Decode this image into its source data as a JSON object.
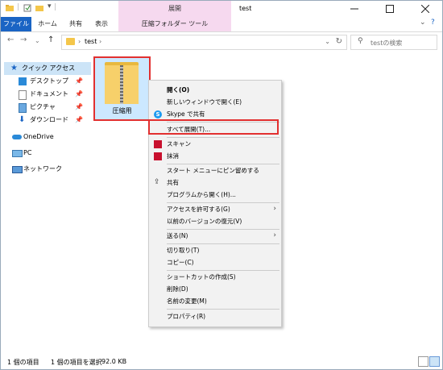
{
  "window": {
    "title": "test"
  },
  "ribbon": {
    "context_group": "展開",
    "tabs": [
      "ファイル",
      "ホーム",
      "共有",
      "表示",
      "圧縮フォルダー ツール"
    ]
  },
  "address": {
    "crumb": "test"
  },
  "search": {
    "placeholder": "testの検索"
  },
  "navpane": {
    "items": [
      {
        "label": "クイック アクセス",
        "icon": "star-icon"
      },
      {
        "label": "デスクトップ",
        "icon": "desktop-icon"
      },
      {
        "label": "ドキュメント",
        "icon": "document-icon"
      },
      {
        "label": "ピクチャ",
        "icon": "picture-icon"
      },
      {
        "label": "ダウンロード",
        "icon": "download-icon"
      },
      {
        "label": "OneDrive",
        "icon": "cloud-icon"
      },
      {
        "label": "PC",
        "icon": "pc-icon"
      },
      {
        "label": "ネットワーク",
        "icon": "network-icon"
      }
    ]
  },
  "file": {
    "name": "圧縮用"
  },
  "context_menu": {
    "items": [
      {
        "label": "開く(O)"
      },
      {
        "label": "新しいウィンドウで開く(E)"
      },
      {
        "label": "Skype で共有"
      },
      {
        "label": "すべて展開(T)..."
      },
      {
        "label": "スキャン"
      },
      {
        "label": "抹消"
      },
      {
        "label": "スタート メニューにピン留めする"
      },
      {
        "label": "共有"
      },
      {
        "label": "プログラムから開く(H)..."
      },
      {
        "label": "アクセスを許可する(G)"
      },
      {
        "label": "以前のバージョンの復元(V)"
      },
      {
        "label": "送る(N)"
      },
      {
        "label": "切り取り(T)"
      },
      {
        "label": "コピー(C)"
      },
      {
        "label": "ショートカットの作成(S)"
      },
      {
        "label": "削除(D)"
      },
      {
        "label": "名前の変更(M)"
      },
      {
        "label": "プロパティ(R)"
      }
    ]
  },
  "status": {
    "count": "1 個の項目",
    "selected": "1 個の項目を選択",
    "size": "92.0 KB"
  },
  "colors": {
    "accent": "#1a64c4",
    "highlight": "#e23030",
    "context_tab": "#f6d9ef"
  }
}
